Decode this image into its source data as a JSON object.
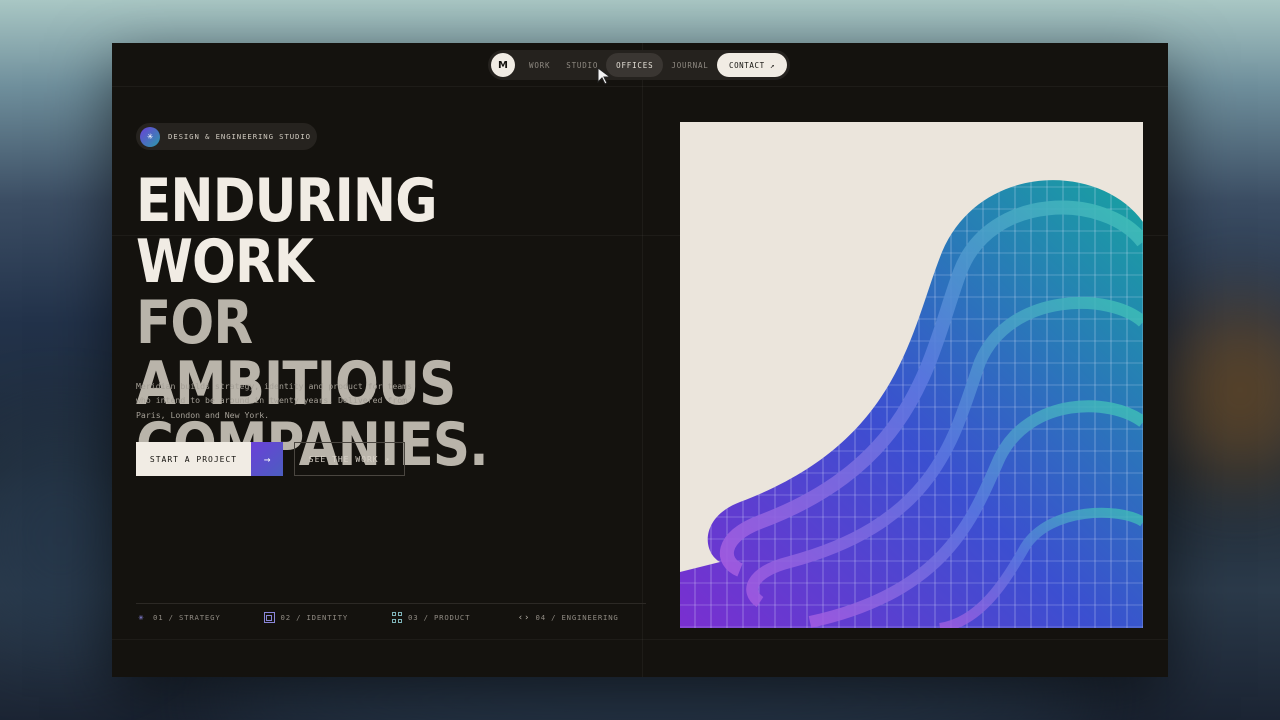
{
  "nav": {
    "logo": "M",
    "items": [
      "WORK",
      "STUDIO",
      "OFFICES",
      "JOURNAL"
    ],
    "active": "OFFICES",
    "cta": "CONTACT ↗"
  },
  "hero": {
    "eyebrow": "DESIGN & ENGINEERING STUDIO",
    "eyebrow_icon": "✳",
    "headline": [
      "ENDURING WORK",
      "FOR AMBITIOUS",
      "COMPANIES."
    ],
    "lede": "Meridian builds strategy, identity and product for teams who intend to be around in twenty years. Delivered from Paris, London and New York.",
    "primary_cta": "START A PROJECT",
    "primary_cta_arrow": "→",
    "secondary_cta": "SEE THE WORK ↗"
  },
  "services": [
    {
      "icon": "asterisk-icon",
      "label": "01 / STRATEGY"
    },
    {
      "icon": "square-icon",
      "label": "02 / IDENTITY"
    },
    {
      "icon": "grid-icon",
      "label": "03 / PRODUCT"
    },
    {
      "icon": "code-icon",
      "label": "04 / ENGINEERING"
    }
  ],
  "colors": {
    "background": "#14120e",
    "text_primary": "#f1ece4",
    "text_secondary": "#b9b4aa",
    "accent_violet": "#6a40d8",
    "accent_teal": "#1aa2a0"
  },
  "image": {
    "subject": "building-facade-icon"
  }
}
